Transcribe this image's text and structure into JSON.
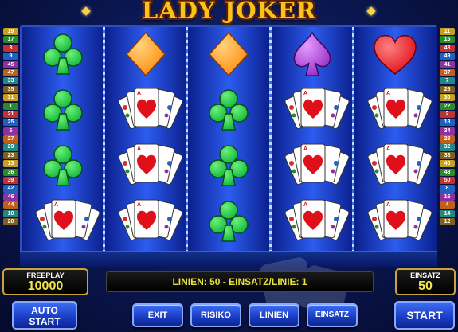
{
  "title": "LADY JOKER",
  "line_numbers_left": [
    "19",
    "17",
    "3",
    "9",
    "45",
    "47",
    "33",
    "35",
    "31",
    "1",
    "21",
    "25",
    "5",
    "27",
    "29",
    "23",
    "13",
    "36",
    "39",
    "42",
    "46",
    "44",
    "10",
    "20"
  ],
  "line_numbers_right": [
    "11",
    "15",
    "43",
    "49",
    "41",
    "37",
    "7",
    "26",
    "30",
    "22",
    "2",
    "18",
    "34",
    "28",
    "32",
    "38",
    "40",
    "48",
    "50",
    "8",
    "16",
    "4",
    "14",
    "12"
  ],
  "reels": [
    [
      "club",
      "club",
      "club",
      "jokers"
    ],
    [
      "diamond",
      "jokers",
      "jokers",
      "jokers"
    ],
    [
      "diamond",
      "club",
      "club",
      "club"
    ],
    [
      "spade",
      "jokers",
      "jokers",
      "jokers"
    ],
    [
      "heart",
      "jokers",
      "jokers",
      "jokers"
    ]
  ],
  "freeplay": {
    "label": "FREEPLAY",
    "value": "10000"
  },
  "status_line": "LINIEN: 50  -  EINSATZ/LINIE: 1",
  "einsatz": {
    "label": "EINSATZ",
    "value": "50"
  },
  "buttons": {
    "auto_start": [
      "AUTO",
      "START"
    ],
    "exit": "EXIT",
    "risiko": "RISIKO",
    "linien": "LINIEN",
    "einsatz": "EINSATZ",
    "start": "START"
  },
  "colors": {
    "club": "#12b83a",
    "diamond": "#ff8c10",
    "spade": "#9a2fc8",
    "heart": "#e0101a",
    "title": "#f7c51a",
    "reel_blue": "#2c5cf0"
  }
}
